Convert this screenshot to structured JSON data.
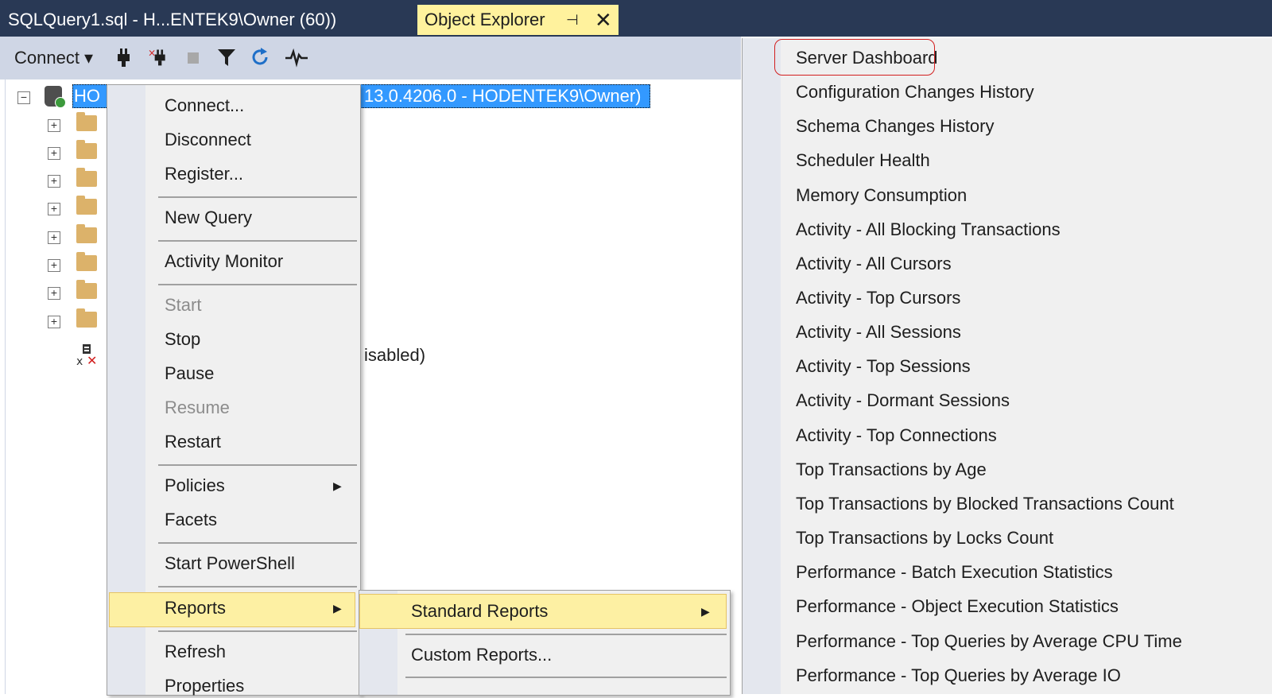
{
  "tabs": {
    "query_tab": "SQLQuery1.sql - H...ENTEK9\\Owner (60))",
    "object_explorer_tab": "Object Explorer",
    "pin_glyph": "⊣",
    "close_glyph": "✕"
  },
  "toolbar": {
    "connect_label": "Connect ▾",
    "icons": [
      "connect-plug-icon",
      "disconnect-plug-icon",
      "stop-icon",
      "filter-icon",
      "refresh-icon",
      "activity-monitor-icon"
    ]
  },
  "tree": {
    "root_label_left": "HO",
    "root_label_right": "13.0.4206.0 - HODENTEK9\\Owner)",
    "root_toggle": "−",
    "node_toggle": "+",
    "disabled_tail": "isabled)"
  },
  "context_menu": {
    "items": [
      {
        "label": "Connect..."
      },
      {
        "label": "Disconnect"
      },
      {
        "label": "Register..."
      },
      {
        "label": "New Query"
      },
      {
        "label": "Activity Monitor"
      },
      {
        "label": "Start",
        "disabled": true
      },
      {
        "label": "Stop"
      },
      {
        "label": "Pause"
      },
      {
        "label": "Resume",
        "disabled": true
      },
      {
        "label": "Restart"
      },
      {
        "label": "Policies",
        "submenu": true
      },
      {
        "label": "Facets"
      },
      {
        "label": "Start PowerShell"
      },
      {
        "label": "Reports",
        "submenu": true,
        "highlighted": true
      },
      {
        "label": "Refresh"
      },
      {
        "label": "Properties"
      }
    ],
    "submenu_arrow": "▶"
  },
  "reports_submenu": {
    "items": [
      {
        "label": "Standard Reports",
        "submenu": true,
        "highlighted": true
      },
      {
        "label": "Custom Reports..."
      }
    ]
  },
  "standard_reports": {
    "items": [
      "Server Dashboard",
      "Configuration Changes History",
      "Schema Changes History",
      "Scheduler Health",
      "Memory Consumption",
      "Activity - All Blocking Transactions",
      "Activity - All Cursors",
      "Activity - Top Cursors",
      "Activity - All Sessions",
      "Activity - Top Sessions",
      "Activity - Dormant Sessions",
      "Activity - Top Connections",
      "Top Transactions by Age",
      "Top Transactions by Blocked Transactions Count",
      "Top Transactions by Locks Count",
      "Performance - Batch Execution Statistics",
      "Performance - Object Execution Statistics",
      "Performance - Top Queries by Average CPU Time",
      "Performance - Top Queries by Average IO"
    ],
    "circled_item": "Server Dashboard",
    "circle_color": "#d21f1f"
  },
  "colors": {
    "title_bar": "#293955",
    "active_tab": "#fff29d",
    "selection": "#3399ff",
    "menu_highlight": "#fdf0a3",
    "menu_bg": "#f0f0f0"
  }
}
